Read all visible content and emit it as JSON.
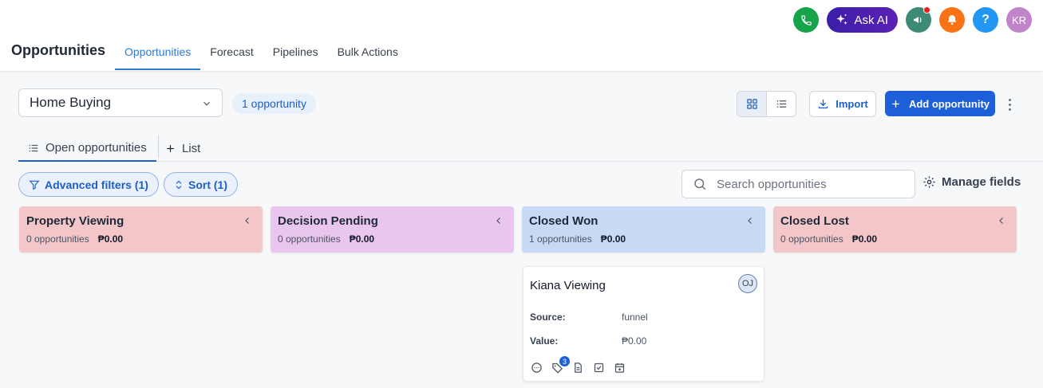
{
  "header": {
    "app_title": "Opportunities",
    "tabs": [
      {
        "label": "Opportunities",
        "active": true
      },
      {
        "label": "Forecast",
        "active": false
      },
      {
        "label": "Pipelines",
        "active": false
      },
      {
        "label": "Bulk Actions",
        "active": false
      }
    ],
    "ask_ai_label": "Ask AI",
    "help_label": "?",
    "avatar_initials": "KR",
    "icons": [
      "phone-icon",
      "sparkle-icon",
      "megaphone-icon",
      "bell-icon",
      "help-icon"
    ]
  },
  "toolbar": {
    "pipeline_selected": "Home Buying",
    "opportunity_count": "1 opportunity",
    "import_label": "Import",
    "add_label": "Add opportunity"
  },
  "subtabs": {
    "open_label": "Open opportunities",
    "list_label": "List"
  },
  "filters": {
    "advanced_label": "Advanced filters (1)",
    "sort_label": "Sort (1)",
    "search_placeholder": "Search opportunities",
    "manage_fields_label": "Manage fields"
  },
  "columns": [
    {
      "title": "Property Viewing",
      "count": "0 opportunities",
      "amount": "₱0.00",
      "color": "#f3c7c9"
    },
    {
      "title": "Decision Pending",
      "count": "0 opportunities",
      "amount": "₱0.00",
      "color": "#e9c6ee"
    },
    {
      "title": "Closed Won",
      "count": "1 opportunities",
      "amount": "₱0.00",
      "color": "#c8d9f4"
    },
    {
      "title": "Closed Lost",
      "count": "0 opportunities",
      "amount": "₱0.00",
      "color": "#f3c7c9"
    }
  ],
  "card": {
    "name": "Kiana Viewing",
    "owner_initials": "OJ",
    "source_label": "Source:",
    "source_value": "funnel",
    "value_label": "Value:",
    "value_value": "₱0.00",
    "tag_count": "3"
  },
  "colors": {
    "primary": "#1d5fd9",
    "tab_active": "#2b7bd6"
  }
}
